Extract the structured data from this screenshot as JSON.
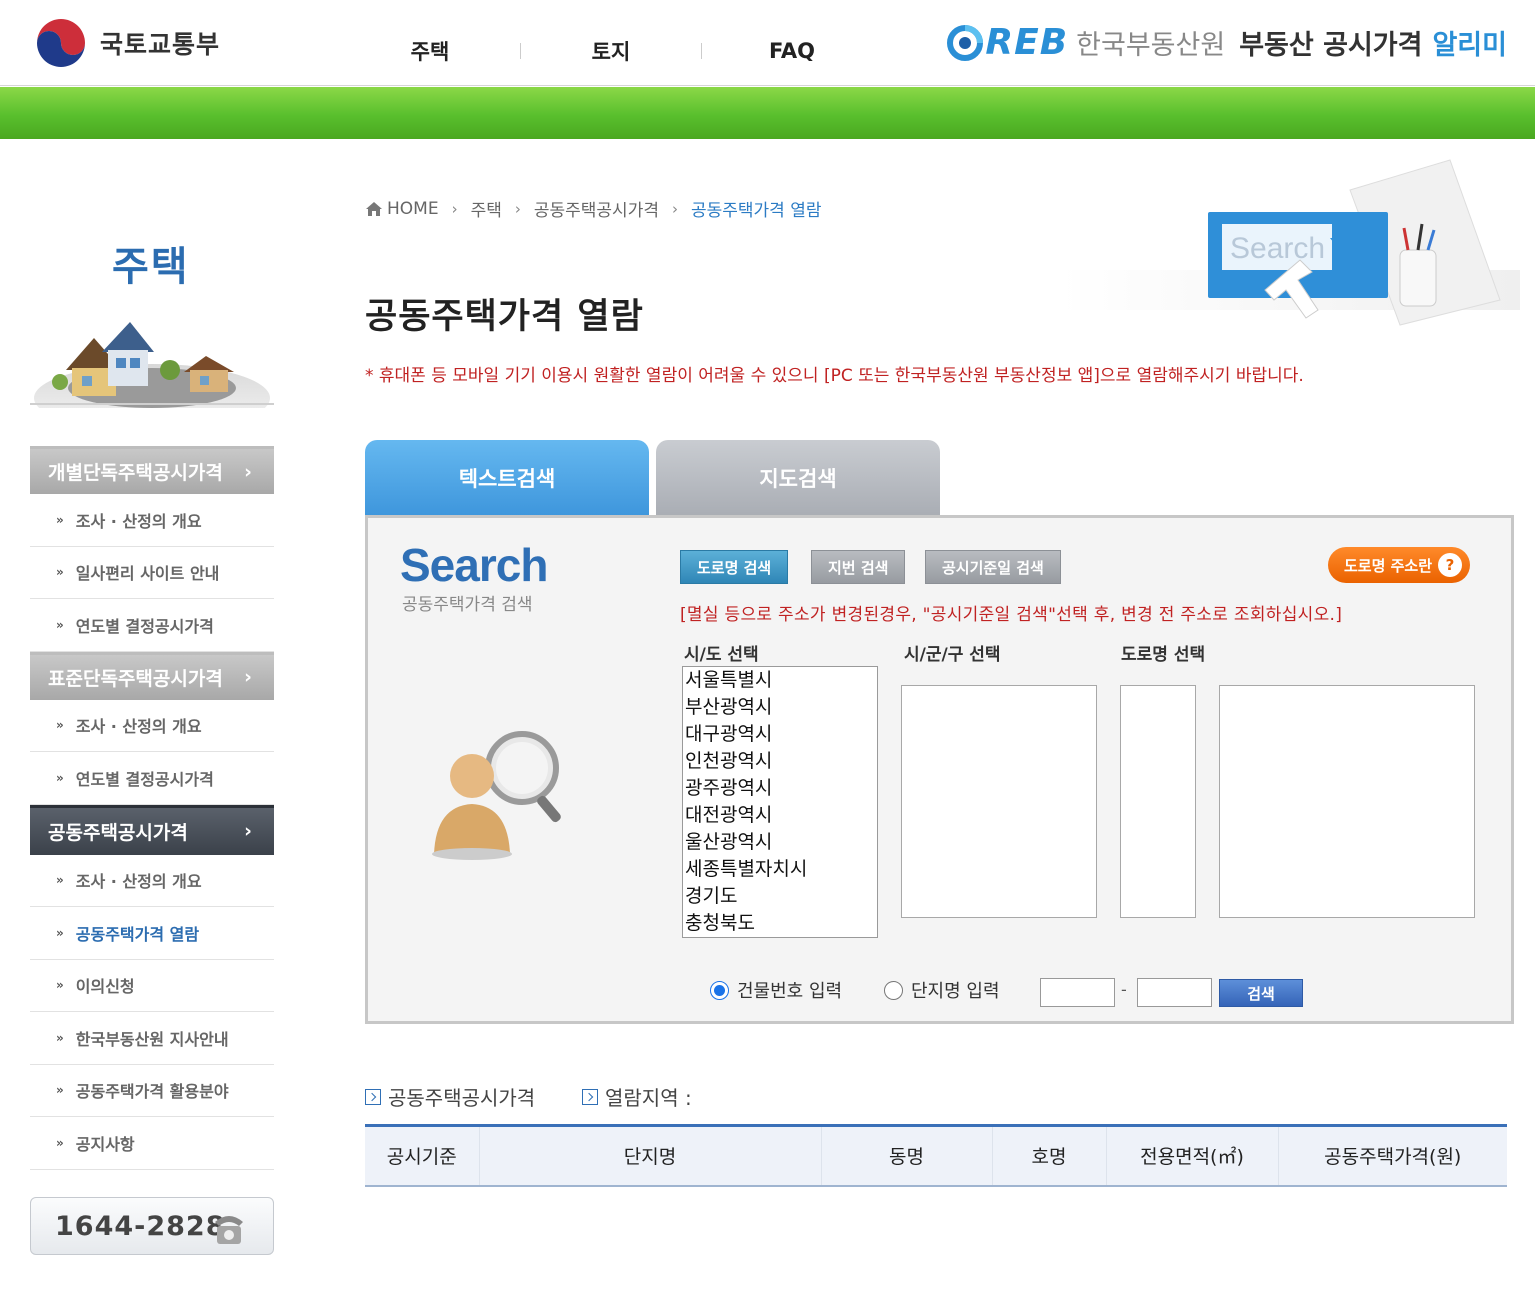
{
  "header": {
    "gov_name": "국토교통부",
    "nav": [
      "주택",
      "토지",
      "FAQ"
    ],
    "brand_logo": "REB",
    "brand_org": "한국부동산원",
    "brand_service": "부동산 공시가격",
    "brand_service_accent": "알리미"
  },
  "sidebar": {
    "title": "주택",
    "groups": [
      {
        "label": "개별단독주택공시가격",
        "items": [
          "조사 · 산정의 개요",
          "일사편리 사이트 안내",
          "연도별 결정공시가격"
        ]
      },
      {
        "label": "표준단독주택공시가격",
        "items": [
          "조사 · 산정의 개요",
          "연도별 결정공시가격"
        ]
      },
      {
        "label": "공동주택공시가격",
        "items": [
          "조사 · 산정의 개요",
          "공동주택가격 열람",
          "이의신청",
          "한국부동산원 지사안내",
          "공동주택가격 활용분야",
          "공지사항"
        ]
      }
    ],
    "phone": "1644-2828"
  },
  "breadcrumb": [
    "HOME",
    "주택",
    "공동주택공시가격",
    "공동주택가격 열람"
  ],
  "hero_word": "Search",
  "page_title": "공동주택가격 열람",
  "notice": "* 휴대폰 등 모바일 기기 이용시 원활한 열람이 어려울 수 있으니 [PC 또는 한국부동산원 부동산정보 앱]으로 열람해주시기 바랍니다.",
  "tabs": [
    "텍스트검색",
    "지도검색"
  ],
  "search": {
    "logo": "Search",
    "logo_sub": "공동주택가격 검색",
    "buttons": [
      "도로명 검색",
      "지번 검색",
      "공시기준일 검색"
    ],
    "road_guide": "도로명 주소란",
    "road_guide_icon": "?",
    "warning": "[멸실 등으로 주소가 변경된경우, \"공시기준일 검색\"선택 후, 변경 전 주소로 조회하십시오.]",
    "col_sido": "시/도 선택",
    "col_sigungu": "시/군/구 선택",
    "col_road": "도로명 선택",
    "sido_options": [
      "서울특별시",
      "부산광역시",
      "대구광역시",
      "인천광역시",
      "광주광역시",
      "대전광역시",
      "울산광역시",
      "세종특별자치시",
      "경기도",
      "충청북도"
    ],
    "radio_building": "건물번호 입력",
    "radio_complex": "단지명 입력",
    "dash": "-",
    "submit": "검색"
  },
  "result": {
    "label_price": "공동주택공시가격",
    "label_region": "열람지역 :",
    "columns": [
      "공시기준",
      "단지명",
      "동명",
      "호명",
      "전용면적(㎡)",
      "공동주택가격(원)"
    ]
  },
  "colors": {
    "green_bar": "#59bf2d",
    "accent_blue": "#2b6cb0",
    "notice_red": "#c02222",
    "orange": "#ea6200"
  }
}
